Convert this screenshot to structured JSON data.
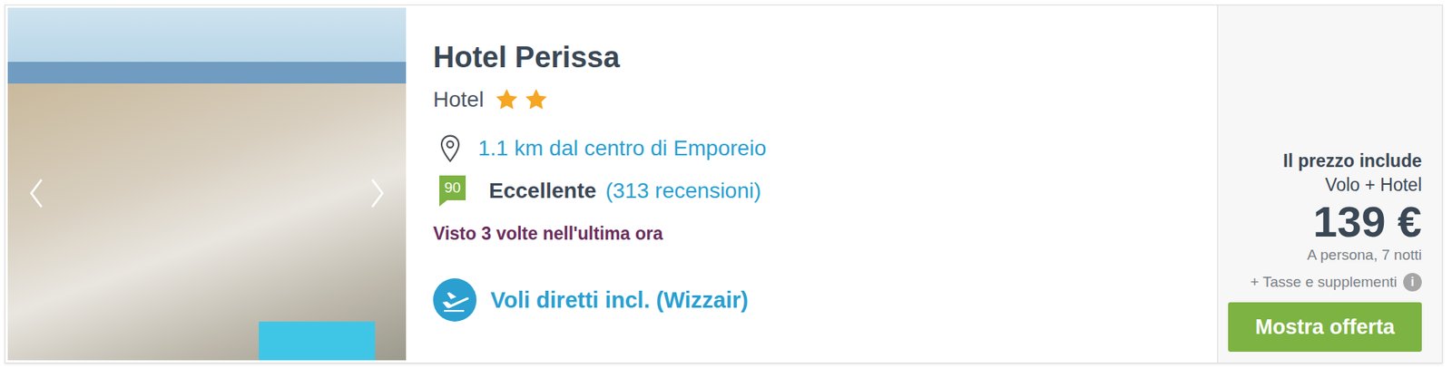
{
  "hotel": {
    "name": "Hotel Perissa",
    "type": "Hotel",
    "stars": 2,
    "distance": "1.1 km dal centro di Emporeio",
    "score": "90",
    "rating": "Eccellente",
    "reviews": "(313 recensioni)",
    "viewed": "Visto 3 volte nell'ultima ora",
    "flights": "Voli diretti incl. (Wizzair)"
  },
  "price": {
    "includes_label": "Il prezzo include",
    "includes": "Volo + Hotel",
    "amount": "139 €",
    "per": "A persona, 7 notti",
    "taxes": "+ Tasse e supplementi",
    "info": "i",
    "button": "Mostra offerta"
  }
}
